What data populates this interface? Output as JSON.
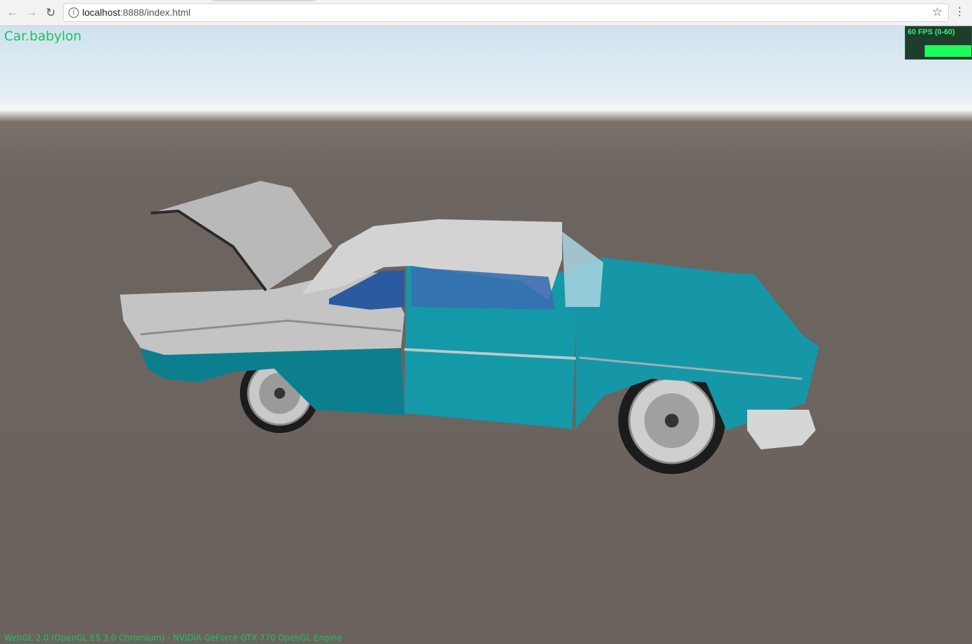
{
  "browser": {
    "url_host": "localhost",
    "url_rest": ":8888/index.html"
  },
  "scene": {
    "title": "Car.babylon",
    "fps_label": "60 FPS (0-60)",
    "fps_fill": 1.0,
    "gpu_info": "WebGL 2.0 (OpenGL ES 3.0 Chromium) - NVIDIA GeForce GTX 770 OpenGL Engine"
  },
  "colors": {
    "overlay_text": "#1bc45a",
    "car_body": "#0f8fa0",
    "car_roof": "#cfcfcf",
    "ground": "#6b625d"
  },
  "icons": [
    "back-icon",
    "forward-icon",
    "reload-icon",
    "info-icon",
    "star-icon",
    "menu-icon"
  ]
}
